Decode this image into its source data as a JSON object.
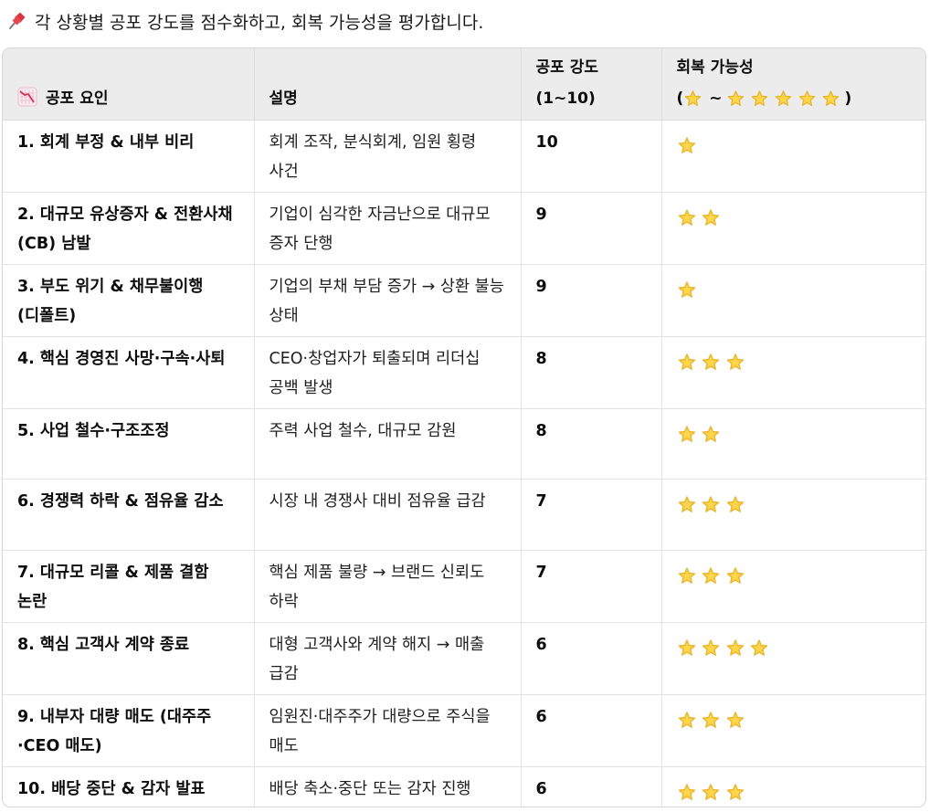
{
  "intro": {
    "icon": "pushpin-icon",
    "text": "각 상황별 공포 강도를 점수화하고, 회복 가능성을 평가합니다."
  },
  "table": {
    "headers": {
      "factor_icon": "chart-decreasing-icon",
      "factor": "공포 요인",
      "description": "설명",
      "intensity_line1": "공포 강도",
      "intensity_line2": "(1~10)",
      "recovery_line1": "회복 가능성",
      "recovery_open": "(",
      "recovery_tilde": "~",
      "recovery_close": ")",
      "recovery_min_stars": 1,
      "recovery_max_stars": 5
    },
    "rows": [
      {
        "factor": "1. 회계 부정 & 내부 비리",
        "description": "회계 조작, 분식회계, 임원 횡령 사건",
        "intensity": "10",
        "recovery": 1
      },
      {
        "factor": "2. 대규모 유상증자 & 전환사채(CB) 남발",
        "description": "기업이 심각한 자금난으로 대규모 증자 단행",
        "intensity": "9",
        "recovery": 2
      },
      {
        "factor": "3. 부도 위기 & 채무불이행(디폴트)",
        "description": "기업의 부채 부담 증가 → 상환 불능 상태",
        "intensity": "9",
        "recovery": 1
      },
      {
        "factor": "4. 핵심 경영진 사망·구속·사퇴",
        "description": "CEO·창업자가 퇴출되며 리더십 공백 발생",
        "intensity": "8",
        "recovery": 3
      },
      {
        "factor": "5. 사업 철수·구조조정",
        "description": "주력 사업 철수, 대규모 감원",
        "intensity": "8",
        "recovery": 2
      },
      {
        "factor": "6. 경쟁력 하락 & 점유율 감소",
        "description": "시장 내 경쟁사 대비 점유율 급감",
        "intensity": "7",
        "recovery": 3
      },
      {
        "factor": "7. 대규모 리콜 & 제품 결함 논란",
        "description": "핵심 제품 불량 → 브랜드 신뢰도 하락",
        "intensity": "7",
        "recovery": 3
      },
      {
        "factor": "8. 핵심 고객사 계약 종료",
        "description": "대형 고객사와 계약 해지 → 매출 급감",
        "intensity": "6",
        "recovery": 4
      },
      {
        "factor": "9. 내부자 대량 매도 (대주주·CEO 매도)",
        "description": "임원진·대주주가 대량으로 주식을 매도",
        "intensity": "6",
        "recovery": 3
      },
      {
        "factor": "10. 배당 중단 & 감자 발표",
        "description": "배당 축소·중단 또는 감자 진행",
        "intensity": "6",
        "recovery": 3
      }
    ]
  },
  "colors": {
    "star_fill": "#FFD54A",
    "star_stroke": "#E9B72E",
    "header_bg": "#ECECEC",
    "border": "#DCDCDC",
    "pin_red": "#D9363E"
  }
}
